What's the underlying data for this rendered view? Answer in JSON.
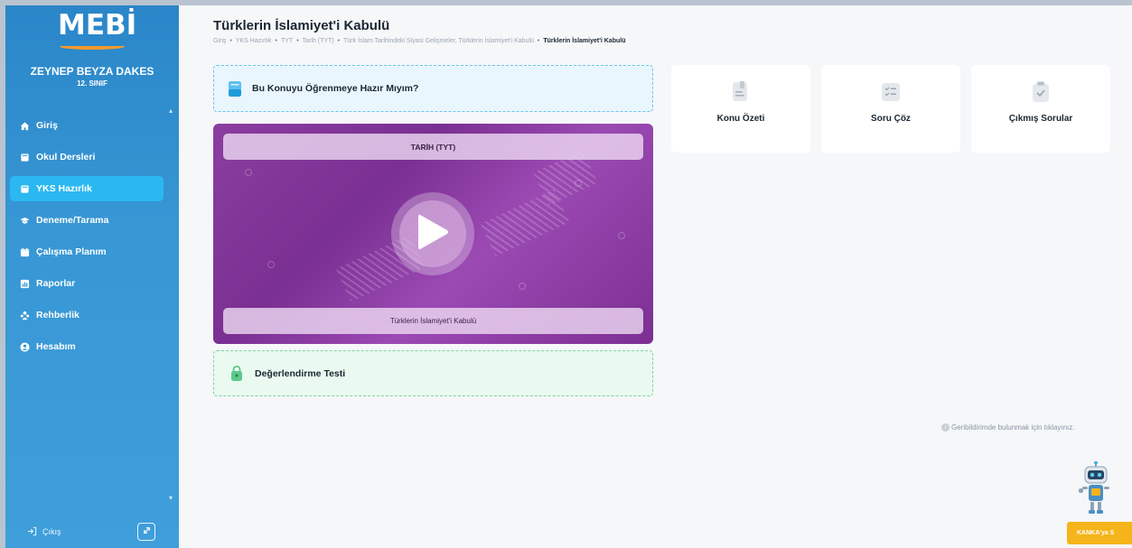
{
  "brand": {
    "logo_text": "MEBİ",
    "accent_color": "#f39a2b"
  },
  "user": {
    "name": "ZEYNEP BEYZA DAKES",
    "class": "12. SINIF"
  },
  "sidebar": {
    "items": [
      {
        "label": "Giriş",
        "icon": "home-icon",
        "active": false
      },
      {
        "label": "Okul Dersleri",
        "icon": "book-icon",
        "active": false
      },
      {
        "label": "YKS Hazırlık",
        "icon": "book-icon",
        "active": true
      },
      {
        "label": "Deneme/Tarama",
        "icon": "graduation-cap-icon",
        "active": false
      },
      {
        "label": "Çalışma Planım",
        "icon": "calendar-icon",
        "active": false
      },
      {
        "label": "Raporlar",
        "icon": "chart-icon",
        "active": false
      },
      {
        "label": "Rehberlik",
        "icon": "users-icon",
        "active": false
      },
      {
        "label": "Hesabım",
        "icon": "user-circle-icon",
        "active": false
      }
    ],
    "logout_label": "Çıkış"
  },
  "main": {
    "title": "Türklerin İslamiyet'i Kabulü",
    "breadcrumb": [
      "Giriş",
      "YKS Hazırlık",
      "TYT",
      "Tarih (TYT)",
      "Türk İslam Tarihindeki Siyasi Gelişmeler, Türklerin İslamiyet'i Kabulü",
      "Türklerin İslamiyet'i Kabulü"
    ],
    "ready_label": "Bu Konuyu Öğrenmeye Hazır Mıyım?",
    "video": {
      "course": "TARİH (TYT)",
      "topic": "Türklerin İslamiyet'i Kabulü"
    },
    "test_label": "Değerlendirme Testi",
    "cards": [
      {
        "label": "Konu Özeti",
        "icon": "document-icon"
      },
      {
        "label": "Soru Çöz",
        "icon": "checklist-icon"
      },
      {
        "label": "Çıkmış Sorular",
        "icon": "clipboard-check-icon"
      }
    ],
    "feedback_text": "Geribildirimde bulunmak için tıklayınız.",
    "assistant_button": "KANKA'ya S"
  }
}
